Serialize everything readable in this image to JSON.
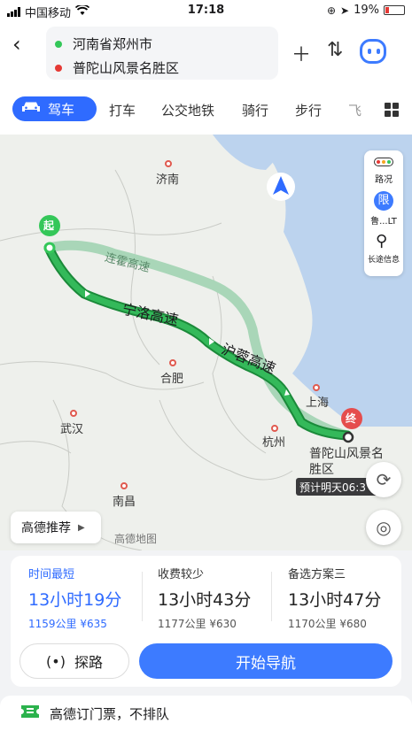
{
  "status_bar": {
    "carrier": "中国移动",
    "time": "17:18",
    "battery": "19%"
  },
  "header": {
    "origin": "河南省郑州市",
    "destination": "普陀山风景名胜区",
    "colors": {
      "origin": "#34c759",
      "destination": "#e53935"
    }
  },
  "modes": {
    "active": "驾车",
    "items": [
      "打车",
      "公交地铁",
      "骑行",
      "步行",
      "飞"
    ]
  },
  "map": {
    "cities": [
      "济南",
      "合肥",
      "上海",
      "杭州",
      "武汉",
      "南昌"
    ],
    "roads": [
      "连霍高速",
      "宁洛高速",
      "沪蓉高速"
    ],
    "start_marker": "起",
    "end_marker": "终",
    "destination_label_line1": "普陀山风景名",
    "destination_label_line2": "胜区",
    "eta_tag": "预计明天06:3",
    "watermark": "高德地图",
    "side_panel": {
      "traffic": "路况",
      "limit_badge": "限",
      "limit_label": "鲁...LT",
      "info": "长途信息"
    },
    "recommend": "高德推荐"
  },
  "plans": [
    {
      "label": "时间最短",
      "duration": "13小时19分",
      "distance": "1159公里",
      "cost": "¥635",
      "selected": true
    },
    {
      "label": "收费较少",
      "duration": "13小时43分",
      "distance": "1177公里",
      "cost": "¥630",
      "selected": false
    },
    {
      "label": "备选方案三",
      "duration": "13小时47分",
      "distance": "1170公里",
      "cost": "¥680",
      "selected": false
    }
  ],
  "actions": {
    "explore": "探路",
    "navigate": "开始导航"
  },
  "promo": "高德订门票，不排队",
  "accent": "#2f6bff"
}
